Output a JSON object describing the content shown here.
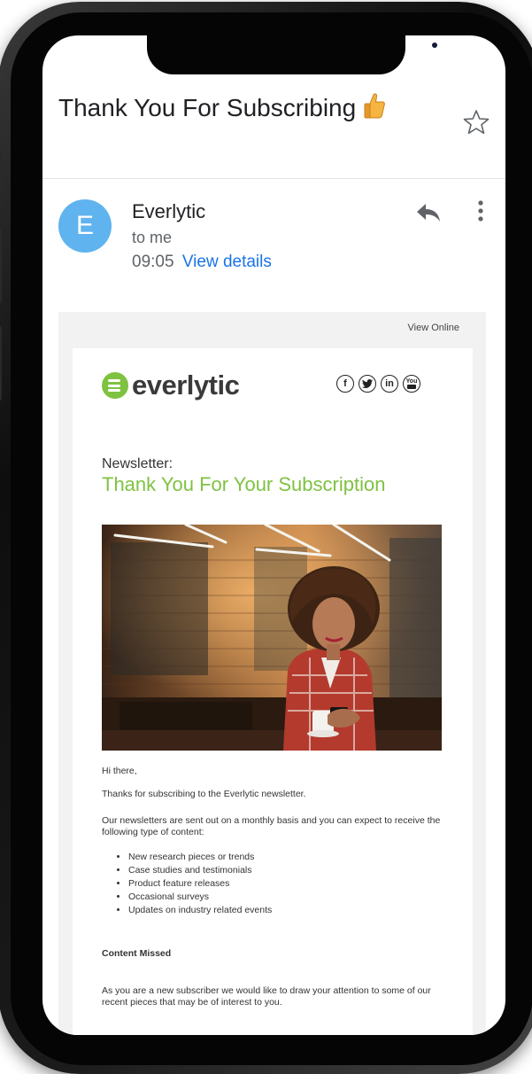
{
  "email": {
    "subject": "Thank You For Subscribing",
    "sender_initial": "E",
    "sender_name": "Everlytic",
    "recipient": "to me",
    "time": "09:05",
    "view_details": "View details"
  },
  "newsletter": {
    "view_online": "View Online",
    "logo_text": "everlytic",
    "social_icons": [
      "facebook-icon",
      "twitter-icon",
      "linkedin-icon",
      "youtube-icon"
    ],
    "social_glyphs": [
      "f",
      "t",
      "in",
      "You"
    ],
    "label": "Newsletter:",
    "title": "Thank You For Your Subscription",
    "greeting": "Hi there,",
    "intro": "Thanks for subscribing to the Everlytic newsletter.",
    "description": "Our newsletters are sent out on a monthly basis and you can expect to receive the following type of content:",
    "content_items": [
      "New research pieces or trends",
      "Case studies and testimonials",
      "Product feature releases",
      "Occasional surveys",
      "Updates on industry related events"
    ],
    "section_heading": "Content Missed",
    "closing": "As you are a new subscriber we would like to draw your attention to some of our recent pieces that may be of interest to you."
  },
  "colors": {
    "accent_green": "#7fc241",
    "link_blue": "#1a73e8",
    "avatar_blue": "#5fb3ee"
  }
}
